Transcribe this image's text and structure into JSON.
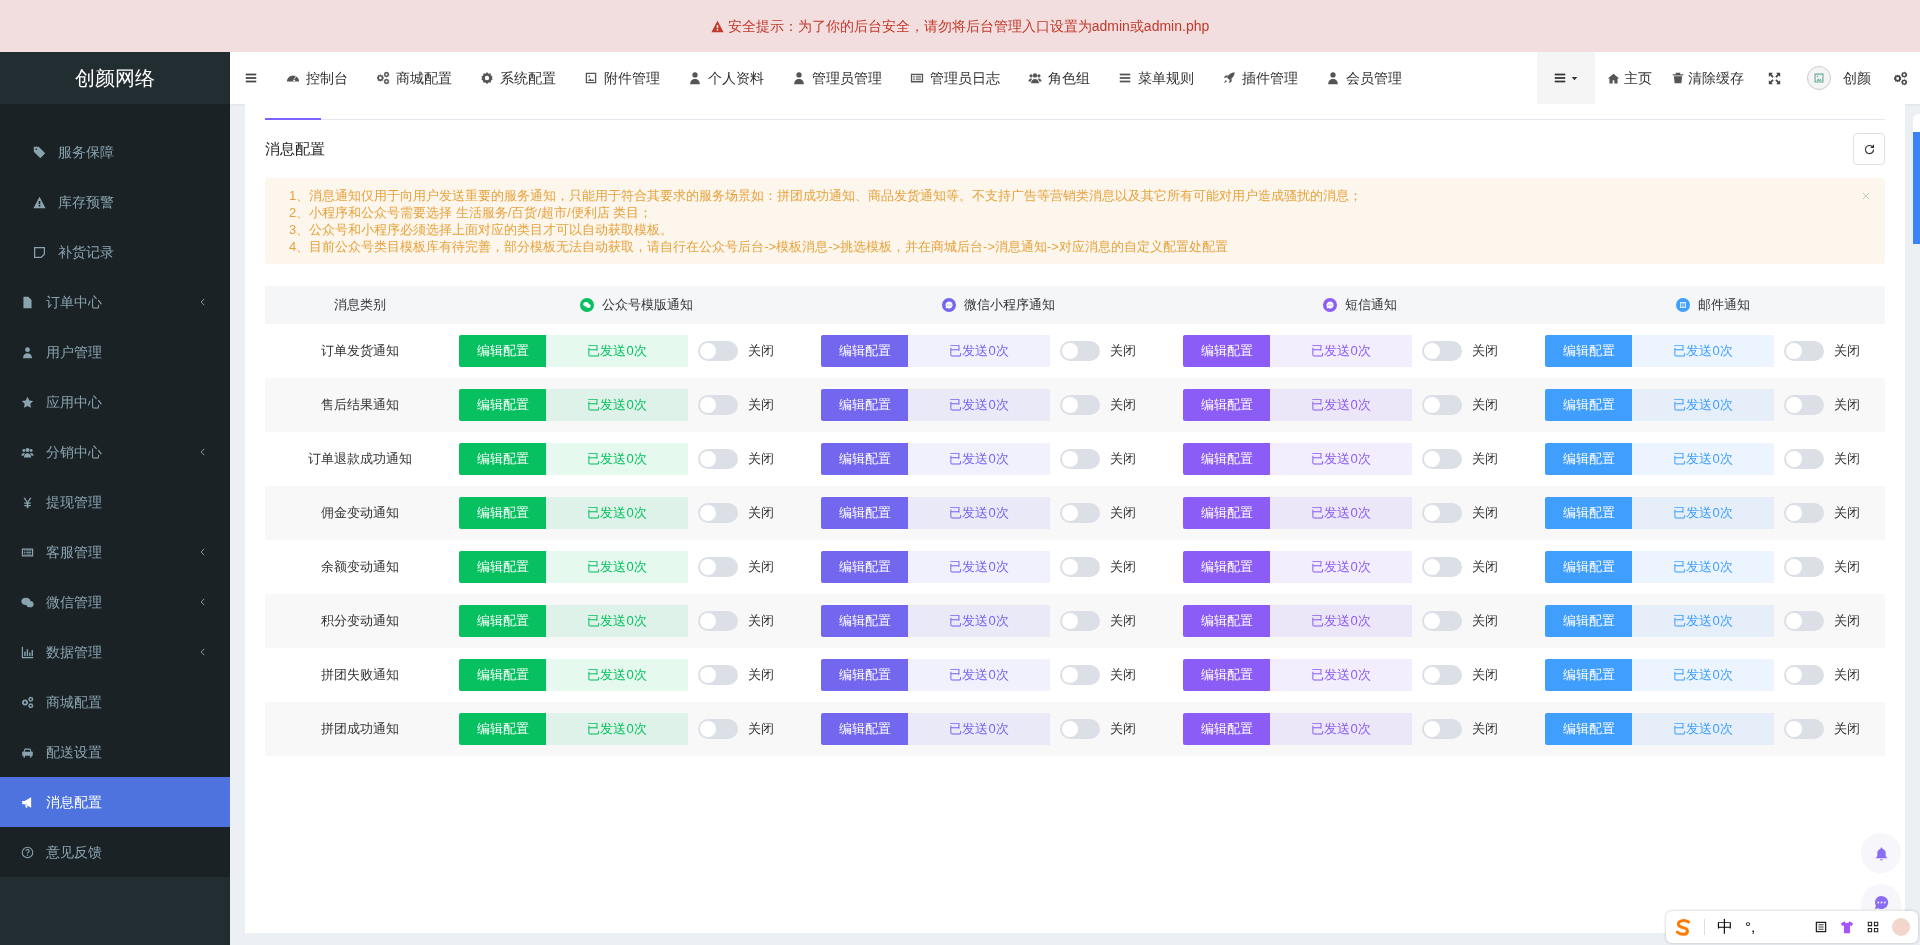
{
  "security_banner": {
    "text": "安全提示：为了你的后台安全，请勿将后台管理入口设置为admin或admin.php"
  },
  "logo": "创颜网络",
  "top_nav": [
    {
      "label": "控制台"
    },
    {
      "label": "商城配置"
    },
    {
      "label": "系统配置"
    },
    {
      "label": "附件管理"
    },
    {
      "label": "个人资料"
    },
    {
      "label": "管理员管理"
    },
    {
      "label": "管理员日志"
    },
    {
      "label": "角色组"
    },
    {
      "label": "菜单规则"
    },
    {
      "label": "插件管理"
    },
    {
      "label": "会员管理"
    }
  ],
  "top_right": {
    "home": "主页",
    "clear_cache": "清除缓存",
    "user_name": "创颜"
  },
  "sidebar": {
    "open_submenu": [
      {
        "label": "服务保障"
      },
      {
        "label": "库存预警"
      },
      {
        "label": "补货记录"
      }
    ],
    "items": [
      {
        "label": "订单中心",
        "expandable": true,
        "selected": false
      },
      {
        "label": "用户管理",
        "expandable": false,
        "selected": false
      },
      {
        "label": "应用中心",
        "expandable": false,
        "selected": false
      },
      {
        "label": "分销中心",
        "expandable": true,
        "selected": false
      },
      {
        "label": "提现管理",
        "expandable": false,
        "selected": false
      },
      {
        "label": "客服管理",
        "expandable": true,
        "selected": false
      },
      {
        "label": "微信管理",
        "expandable": true,
        "selected": false
      },
      {
        "label": "数据管理",
        "expandable": true,
        "selected": false
      },
      {
        "label": "商城配置",
        "expandable": false,
        "selected": false
      },
      {
        "label": "配送设置",
        "expandable": false,
        "selected": false
      },
      {
        "label": "消息配置",
        "expandable": false,
        "selected": true
      },
      {
        "label": "意见反馈",
        "expandable": false,
        "selected": false
      }
    ]
  },
  "panel": {
    "title": "消息配置",
    "notice": [
      "1、消息通知仅用于向用户发送重要的服务通知，只能用于符合其要求的服务场景如：拼团成功通知、商品发货通知等。不支持广告等营销类消息以及其它所有可能对用户造成骚扰的消息；",
      "2、小程序和公众号需要选择 生活服务/百货/超市/便利店 类目；",
      "3、公众号和小程序必须选择上面对应的类目才可以自动获取模板。",
      "4、目前公众号类目模板库有待完善，部分模板无法自动获取，请自行在公众号后台->模板消息->挑选模板，并在商城后台->消息通知->对应消息的自定义配置处配置"
    ],
    "table": {
      "category_header": "消息类别",
      "channels": [
        {
          "kind": "official_account",
          "label": "公众号模版通知",
          "color": "#07c160"
        },
        {
          "kind": "mini_program",
          "label": "微信小程序通知",
          "color": "#7367f0"
        },
        {
          "kind": "sms",
          "label": "短信通知",
          "color": "#8c5cf6"
        },
        {
          "kind": "email",
          "label": "邮件通知",
          "color": "#409eff"
        }
      ],
      "rows": [
        {
          "name": "订单发货通知",
          "cells": [
            {
              "button": "编辑配置",
              "sent": "已发送0次",
              "on": false,
              "toggle_label": "关闭"
            },
            {
              "button": "编辑配置",
              "sent": "已发送0次",
              "on": false,
              "toggle_label": "关闭"
            },
            {
              "button": "编辑配置",
              "sent": "已发送0次",
              "on": false,
              "toggle_label": "关闭"
            },
            {
              "button": "编辑配置",
              "sent": "已发送0次",
              "on": false,
              "toggle_label": "关闭"
            }
          ]
        },
        {
          "name": "售后结果通知",
          "cells": [
            {
              "button": "编辑配置",
              "sent": "已发送0次",
              "on": false,
              "toggle_label": "关闭"
            },
            {
              "button": "编辑配置",
              "sent": "已发送0次",
              "on": false,
              "toggle_label": "关闭"
            },
            {
              "button": "编辑配置",
              "sent": "已发送0次",
              "on": false,
              "toggle_label": "关闭"
            },
            {
              "button": "编辑配置",
              "sent": "已发送0次",
              "on": false,
              "toggle_label": "关闭"
            }
          ]
        },
        {
          "name": "订单退款成功通知",
          "cells": [
            {
              "button": "编辑配置",
              "sent": "已发送0次",
              "on": false,
              "toggle_label": "关闭"
            },
            {
              "button": "编辑配置",
              "sent": "已发送0次",
              "on": false,
              "toggle_label": "关闭"
            },
            {
              "button": "编辑配置",
              "sent": "已发送0次",
              "on": false,
              "toggle_label": "关闭"
            },
            {
              "button": "编辑配置",
              "sent": "已发送0次",
              "on": false,
              "toggle_label": "关闭"
            }
          ]
        },
        {
          "name": "佣金变动通知",
          "cells": [
            {
              "button": "编辑配置",
              "sent": "已发送0次",
              "on": false,
              "toggle_label": "关闭"
            },
            {
              "button": "编辑配置",
              "sent": "已发送0次",
              "on": false,
              "toggle_label": "关闭"
            },
            {
              "button": "编辑配置",
              "sent": "已发送0次",
              "on": false,
              "toggle_label": "关闭"
            },
            {
              "button": "编辑配置",
              "sent": "已发送0次",
              "on": false,
              "toggle_label": "关闭"
            }
          ]
        },
        {
          "name": "余额变动通知",
          "cells": [
            {
              "button": "编辑配置",
              "sent": "已发送0次",
              "on": false,
              "toggle_label": "关闭"
            },
            {
              "button": "编辑配置",
              "sent": "已发送0次",
              "on": false,
              "toggle_label": "关闭"
            },
            {
              "button": "编辑配置",
              "sent": "已发送0次",
              "on": false,
              "toggle_label": "关闭"
            },
            {
              "button": "编辑配置",
              "sent": "已发送0次",
              "on": false,
              "toggle_label": "关闭"
            }
          ]
        },
        {
          "name": "积分变动通知",
          "cells": [
            {
              "button": "编辑配置",
              "sent": "已发送0次",
              "on": false,
              "toggle_label": "关闭"
            },
            {
              "button": "编辑配置",
              "sent": "已发送0次",
              "on": false,
              "toggle_label": "关闭"
            },
            {
              "button": "编辑配置",
              "sent": "已发送0次",
              "on": false,
              "toggle_label": "关闭"
            },
            {
              "button": "编辑配置",
              "sent": "已发送0次",
              "on": false,
              "toggle_label": "关闭"
            }
          ]
        },
        {
          "name": "拼团失败通知",
          "cells": [
            {
              "button": "编辑配置",
              "sent": "已发送0次",
              "on": false,
              "toggle_label": "关闭"
            },
            {
              "button": "编辑配置",
              "sent": "已发送0次",
              "on": false,
              "toggle_label": "关闭"
            },
            {
              "button": "编辑配置",
              "sent": "已发送0次",
              "on": false,
              "toggle_label": "关闭"
            },
            {
              "button": "编辑配置",
              "sent": "已发送0次",
              "on": false,
              "toggle_label": "关闭"
            }
          ]
        },
        {
          "name": "拼团成功通知",
          "cells": [
            {
              "button": "编辑配置",
              "sent": "已发送0次",
              "on": false,
              "toggle_label": "关闭"
            },
            {
              "button": "编辑配置",
              "sent": "已发送0次",
              "on": false,
              "toggle_label": "关闭"
            },
            {
              "button": "编辑配置",
              "sent": "已发送0次",
              "on": false,
              "toggle_label": "关闭"
            },
            {
              "button": "编辑配置",
              "sent": "已发送0次",
              "on": false,
              "toggle_label": "关闭"
            }
          ]
        }
      ]
    }
  },
  "ime_toolbar": {
    "mode": "中",
    "punctuation": "°,"
  }
}
